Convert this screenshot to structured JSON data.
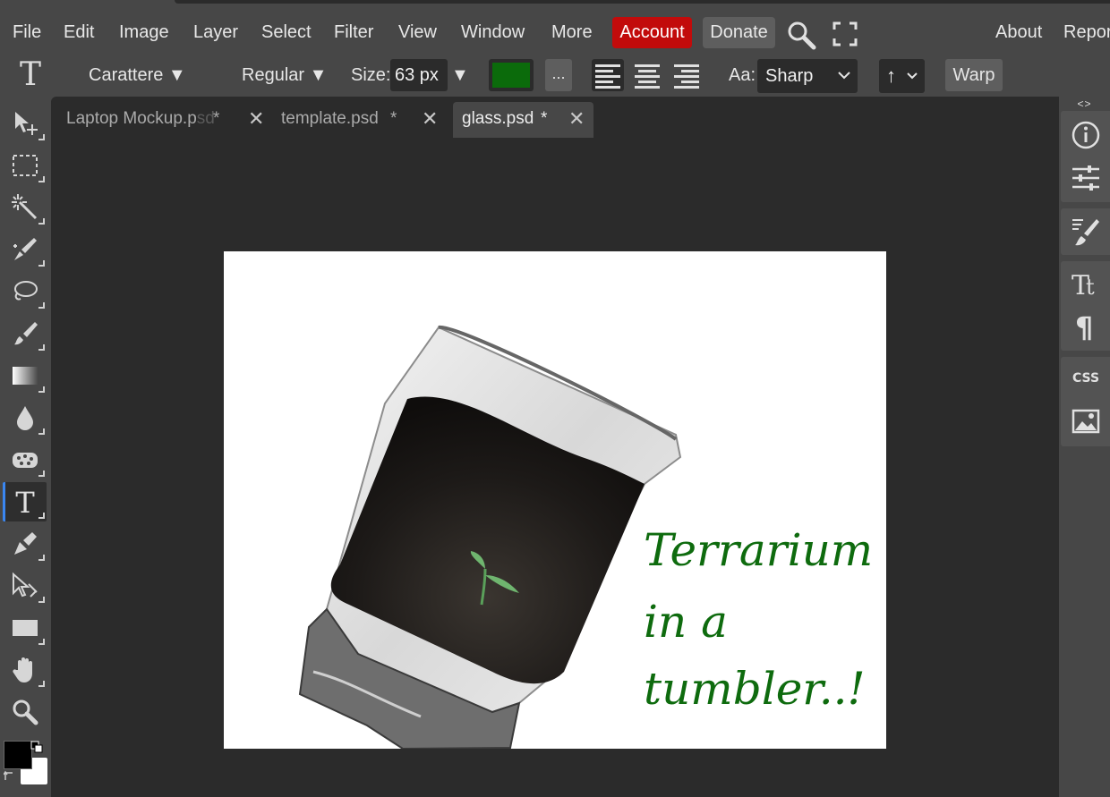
{
  "menu": {
    "items": [
      "File",
      "Edit",
      "Image",
      "Layer",
      "Select",
      "Filter",
      "View",
      "Window",
      "More"
    ],
    "account": "Account",
    "donate": "Donate",
    "about": "About",
    "report": "Repor"
  },
  "options": {
    "font_family": "Carattere ▼",
    "font_style": "Regular ▼",
    "size_label": "Size:",
    "size_value": "63 px",
    "size_arrow": "▼",
    "color": "#0b6b0b",
    "more": "...",
    "aa_label": "Aa:",
    "aa_value": "Sharp",
    "direction": "↑",
    "warp": "Warp"
  },
  "tabs": [
    {
      "name": "Laptop Mockup.p",
      "faded": "sd",
      "dirty": "*"
    },
    {
      "name": "template.psd",
      "dirty": "*"
    },
    {
      "name": "glass.psd",
      "dirty": "*"
    }
  ],
  "canvas": {
    "lines": [
      "Terrarium",
      "in a",
      "tumbler..!"
    ],
    "text_color": "#0e6b0e"
  },
  "right_panel": {
    "css_label": "CSS",
    "collapse": "<>"
  },
  "colors": {
    "foreground": "#000000",
    "background": "#ffffff",
    "accent": "#3a86f0",
    "account_red": "#c20b0b"
  }
}
